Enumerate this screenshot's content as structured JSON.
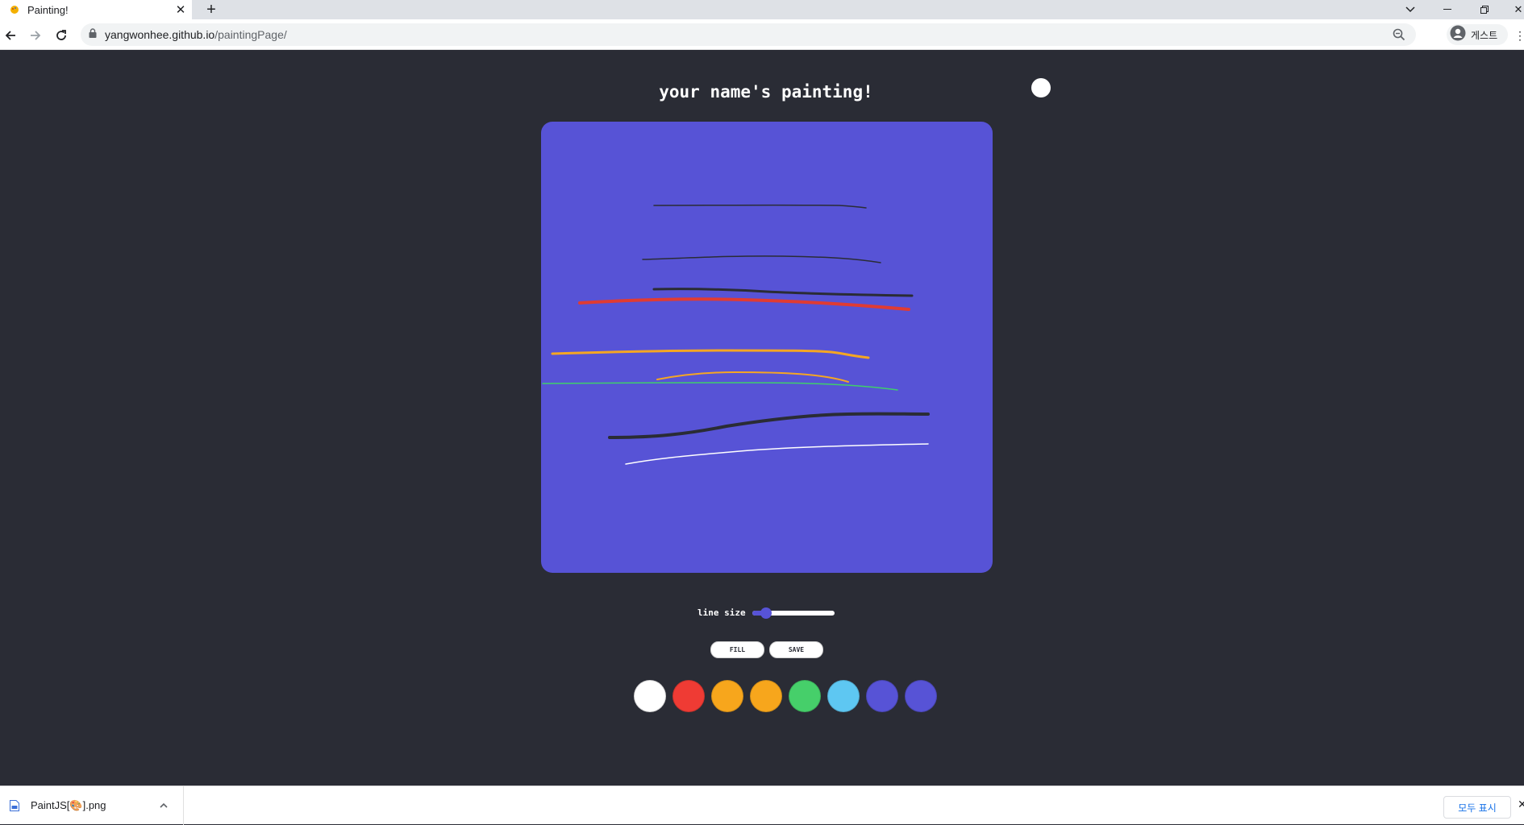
{
  "browser": {
    "tab_title": "Painting!",
    "tab_close_icon": "close-icon",
    "new_tab_icon": "plus-icon",
    "address": {
      "host": "yangwonhee.github.io",
      "path": "/paintingPage/"
    },
    "profile_label": "게스트",
    "window_controls": [
      "tab-search-icon",
      "minimize-icon",
      "restore-icon",
      "close-icon"
    ]
  },
  "page": {
    "title": "your name's painting!",
    "canvas_color": "#5753d6",
    "strokes": [
      {
        "color": "#2a2c35",
        "width": 1.5
      },
      {
        "color": "#2a2c35",
        "width": 1.5
      },
      {
        "color": "#2a2c35",
        "width": 3
      },
      {
        "color": "#e03b33",
        "width": 4
      },
      {
        "color": "#f5a623",
        "width": 3
      },
      {
        "color": "#f5a623",
        "width": 2
      },
      {
        "color": "#3fcf6a",
        "width": 1.5
      },
      {
        "color": "#2a2c35",
        "width": 4
      },
      {
        "color": "#ffffff",
        "width": 1.5
      }
    ],
    "range": {
      "label": "line size",
      "value": 0.17
    },
    "buttons": {
      "fill": "FILL",
      "save": "SAVE"
    },
    "colors": [
      "#ffffff",
      "#ef3b34",
      "#f7a61c",
      "#f7a61c",
      "#46cf6a",
      "#5ec7f2",
      "#5753d6",
      "#5753d6"
    ]
  },
  "downloads": {
    "file_name": "PaintJS[🎨].png",
    "show_all": "모두 표시"
  }
}
